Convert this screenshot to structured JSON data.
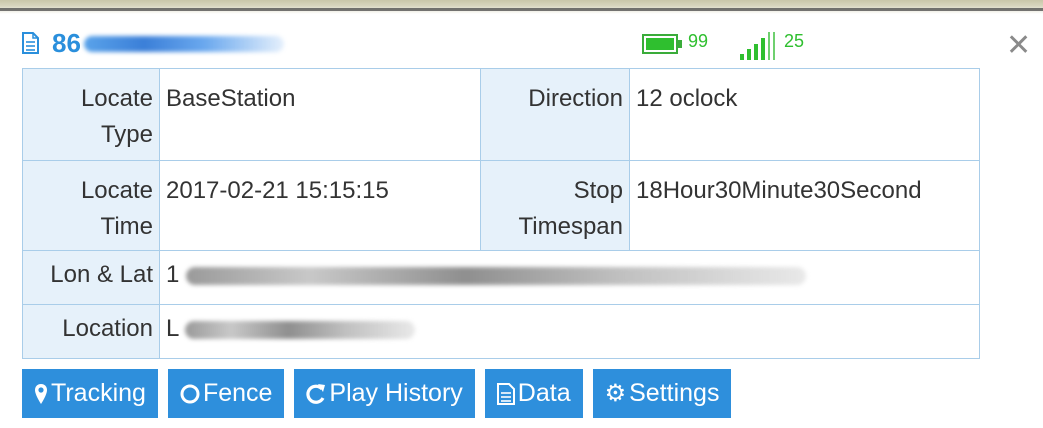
{
  "header": {
    "device_id": "86",
    "battery_value": "99",
    "battery_icon": "battery-icon",
    "signal_value": "25",
    "signal_icon": "signal-icon",
    "close_icon": "close-icon",
    "accent_color": "#2e8fdc",
    "status_color": "#2fbf2f"
  },
  "info": {
    "locate_type_label": "Locate Type",
    "locate_type_value": "BaseStation",
    "direction_label": "Direction",
    "direction_value": "12 oclock",
    "locate_time_label": "Locate Time",
    "locate_time_value": "2017-02-21 15:15:15",
    "stop_timespan_label": "Stop Timespan",
    "stop_timespan_value": "18Hour30Minute30Second",
    "lonlat_label": "Lon & Lat",
    "lonlat_value_visible": "1",
    "location_label": "Location",
    "location_value_visible": "L"
  },
  "buttons": {
    "tracking": "Tracking",
    "fence": "Fence",
    "play_history": "Play History",
    "data": "Data",
    "settings": "Settings"
  }
}
